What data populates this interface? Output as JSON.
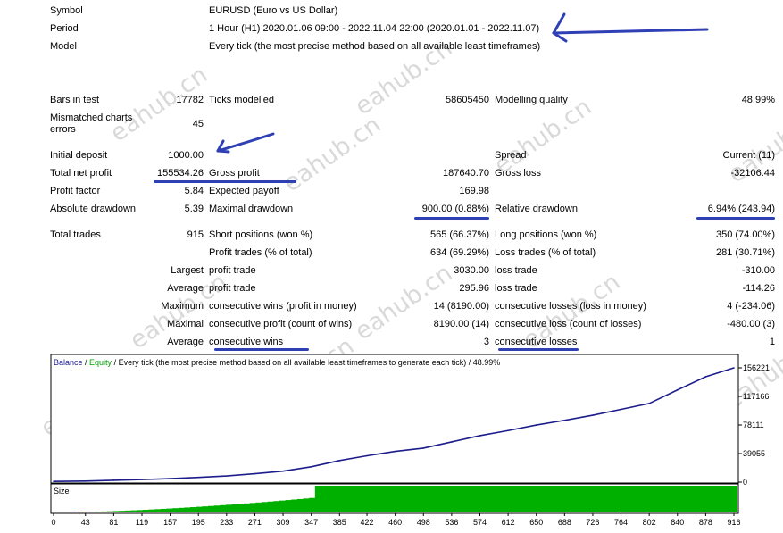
{
  "header": {
    "symbol_label": "Symbol",
    "symbol_value": "EURUSD (Euro vs US Dollar)",
    "period_label": "Period",
    "period_value": "1 Hour (H1) 2020.01.06 09:00 - 2022.11.04 22:00 (2020.01.01 - 2022.11.07)",
    "model_label": "Model",
    "model_value": "Every tick (the most precise method based on all available least timeframes)"
  },
  "stats": {
    "bars_label": "Bars in test",
    "bars_value": "17782",
    "ticks_label": "Ticks modelled",
    "ticks_value": "58605450",
    "mq_label": "Modelling quality",
    "mq_value": "48.99%",
    "mismatch_label_1": "Mismatched charts",
    "mismatch_label_2": "errors",
    "mismatch_value": "45",
    "deposit_label": "Initial deposit",
    "deposit_value": "1000.00",
    "spread_label": "Spread",
    "spread_value": "Current (11)",
    "netprofit_label": "Total net profit",
    "netprofit_value": "155534.26",
    "grossprofit_label": "Gross profit",
    "grossprofit_value": "187640.70",
    "grossloss_label": "Gross loss",
    "grossloss_value": "-32106.44",
    "pf_label": "Profit factor",
    "pf_value": "5.84",
    "ep_label": "Expected payoff",
    "ep_value": "169.98",
    "absdd_label": "Absolute drawdown",
    "absdd_value": "5.39",
    "maxdd_label": "Maximal drawdown",
    "maxdd_value": "900.00 (0.88%)",
    "reldd_label": "Relative drawdown",
    "reldd_value": "6.94% (243.94)",
    "trades_label": "Total trades",
    "trades_value": "915",
    "short_label": "Short positions (won %)",
    "short_value": "565 (66.37%)",
    "long_label": "Long positions (won %)",
    "long_value": "350 (74.00%)",
    "ptrades_label": "Profit trades (% of total)",
    "ptrades_value": "634 (69.29%)",
    "ltrades_label": "Loss trades (% of total)",
    "ltrades_value": "281 (30.71%)",
    "largest_label": "Largest",
    "largest_profit_label": "profit trade",
    "largest_profit_value": "3030.00",
    "largest_loss_label": "loss trade",
    "largest_loss_value": "-310.00",
    "average_label": "Average",
    "avg_profit_label": "profit trade",
    "avg_profit_value": "295.96",
    "avg_loss_label": "loss trade",
    "avg_loss_value": "-114.26",
    "maximum_label": "Maximum",
    "max_cw_label": "consecutive wins (profit in money)",
    "max_cw_value": "14 (8190.00)",
    "max_cl_label": "consecutive losses (loss in money)",
    "max_cl_value": "4 (-234.06)",
    "maximal_label": "Maximal",
    "mxl_cp_label": "consecutive profit (count of wins)",
    "mxl_cp_value": "8190.00 (14)",
    "mxl_cl_label": "consecutive loss (count of losses)",
    "mxl_cl_value": "-480.00 (3)",
    "average2_label": "Average",
    "avg_cw_label": "consecutive wins",
    "avg_cw_value": "3",
    "avg_cl_label": "consecutive losses",
    "avg_cl_value": "1"
  },
  "watermark": "eahub.cn",
  "chart_data": {
    "type": "line",
    "legend": {
      "balance": "Balance",
      "sep1": " / ",
      "equity": "Equity",
      "rest": " / Every tick (the most precise method based on all available least timeframes to generate each tick) / 48.99%"
    },
    "colors": {
      "balance": "#1c1c8c",
      "equity": "#00a000",
      "size": "#00b000"
    },
    "yticks": [
      0,
      39055,
      78111,
      117166,
      156221
    ],
    "xticks": [
      0,
      43,
      81,
      119,
      157,
      195,
      233,
      271,
      309,
      347,
      385,
      422,
      460,
      498,
      536,
      574,
      612,
      650,
      688,
      726,
      764,
      802,
      840,
      878,
      916
    ],
    "ylim": [
      0,
      156221
    ],
    "xlim": [
      0,
      916
    ],
    "series": [
      {
        "name": "Balance",
        "x": [
          0,
          43,
          81,
          119,
          157,
          195,
          233,
          271,
          309,
          347,
          385,
          422,
          460,
          498,
          536,
          574,
          612,
          650,
          688,
          726,
          764,
          802,
          840,
          878,
          916
        ],
        "values": [
          1000,
          1500,
          2500,
          3500,
          4800,
          6500,
          8500,
          11500,
          15000,
          21000,
          29500,
          36000,
          42000,
          46500,
          55000,
          63500,
          70500,
          78000,
          84500,
          91500,
          99500,
          107500,
          126000,
          144000,
          156221
        ]
      }
    ],
    "size_panel": {
      "label": "Size",
      "ramp_end_x": 347,
      "level_after": 1.0
    }
  }
}
